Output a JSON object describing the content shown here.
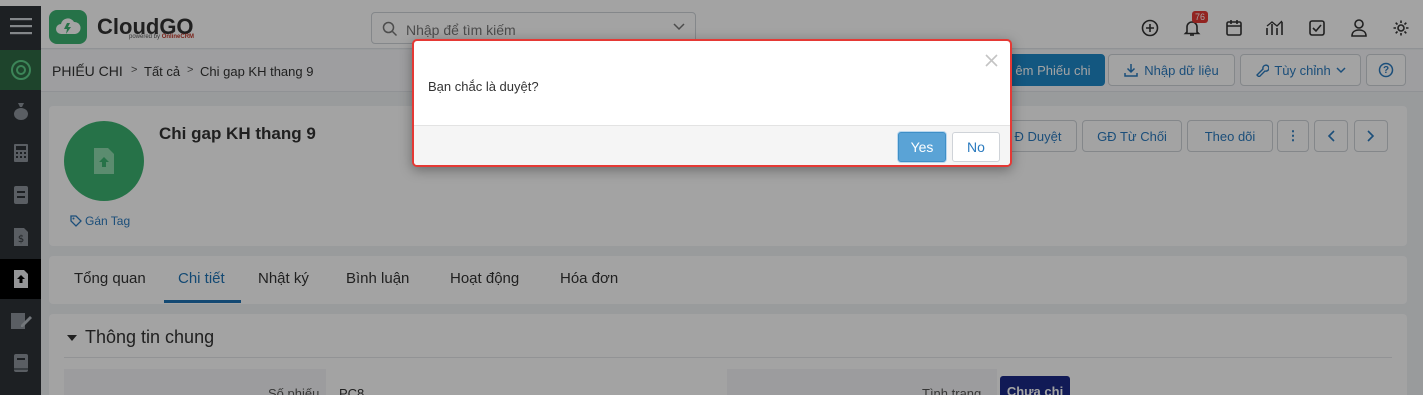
{
  "app": {
    "logo_text": "CloudGO",
    "logo_sub_prefix": "powered by ",
    "logo_sub_brand": "OnlineCRM"
  },
  "header": {
    "search_placeholder": "Nhập để tìm kiếm",
    "notification_count": "76",
    "icons": [
      "plus-circle-icon",
      "bell-icon",
      "calendar-icon",
      "chart-icon",
      "checkbox-icon",
      "user-icon",
      "gear-icon"
    ]
  },
  "sidebar": {
    "icons": [
      "menu-icon",
      "circle-target-icon",
      "money-bag-icon",
      "calculator-icon",
      "register-icon",
      "dollar-doc-icon",
      "upload-doc-icon",
      "edit-doc-icon",
      "book-icon"
    ]
  },
  "breadcrumb": {
    "module": "PHIẾU CHI",
    "view": "Tất cả",
    "record": "Chi gap KH thang 9"
  },
  "toolbar": {
    "add_label": "êm Phiếu chi",
    "import_label": "Nhập dữ liệu",
    "customize_label": "Tùy chỉnh",
    "help_label": "?"
  },
  "record": {
    "title": "Chi gap KH thang 9",
    "tag_label": "Gán Tag",
    "actions": {
      "approve_label": "Đ Duyệt",
      "reject_label": "GĐ Từ Chối",
      "follow_label": "Theo dõi",
      "more_label": "⋮"
    }
  },
  "tabs": [
    "Tổng quan",
    "Chi tiết",
    "Nhật ký",
    "Bình luận",
    "Hoạt động",
    "Hóa đơn"
  ],
  "active_tab": "Chi tiết",
  "section": {
    "title": "Thông tin chung",
    "fields": {
      "code_label": "Số phiếu",
      "code_value": "PC8",
      "status_label": "Tình trạng",
      "status_value": "Chưa chi"
    }
  },
  "modal": {
    "message": "Bạn chắc là duyệt?",
    "yes_label": "Yes",
    "no_label": "No"
  },
  "colors": {
    "accent": "#1e88c9",
    "brand_green": "#3cb371",
    "modal_border": "#e53935",
    "status_badge": "#1b2a87"
  }
}
